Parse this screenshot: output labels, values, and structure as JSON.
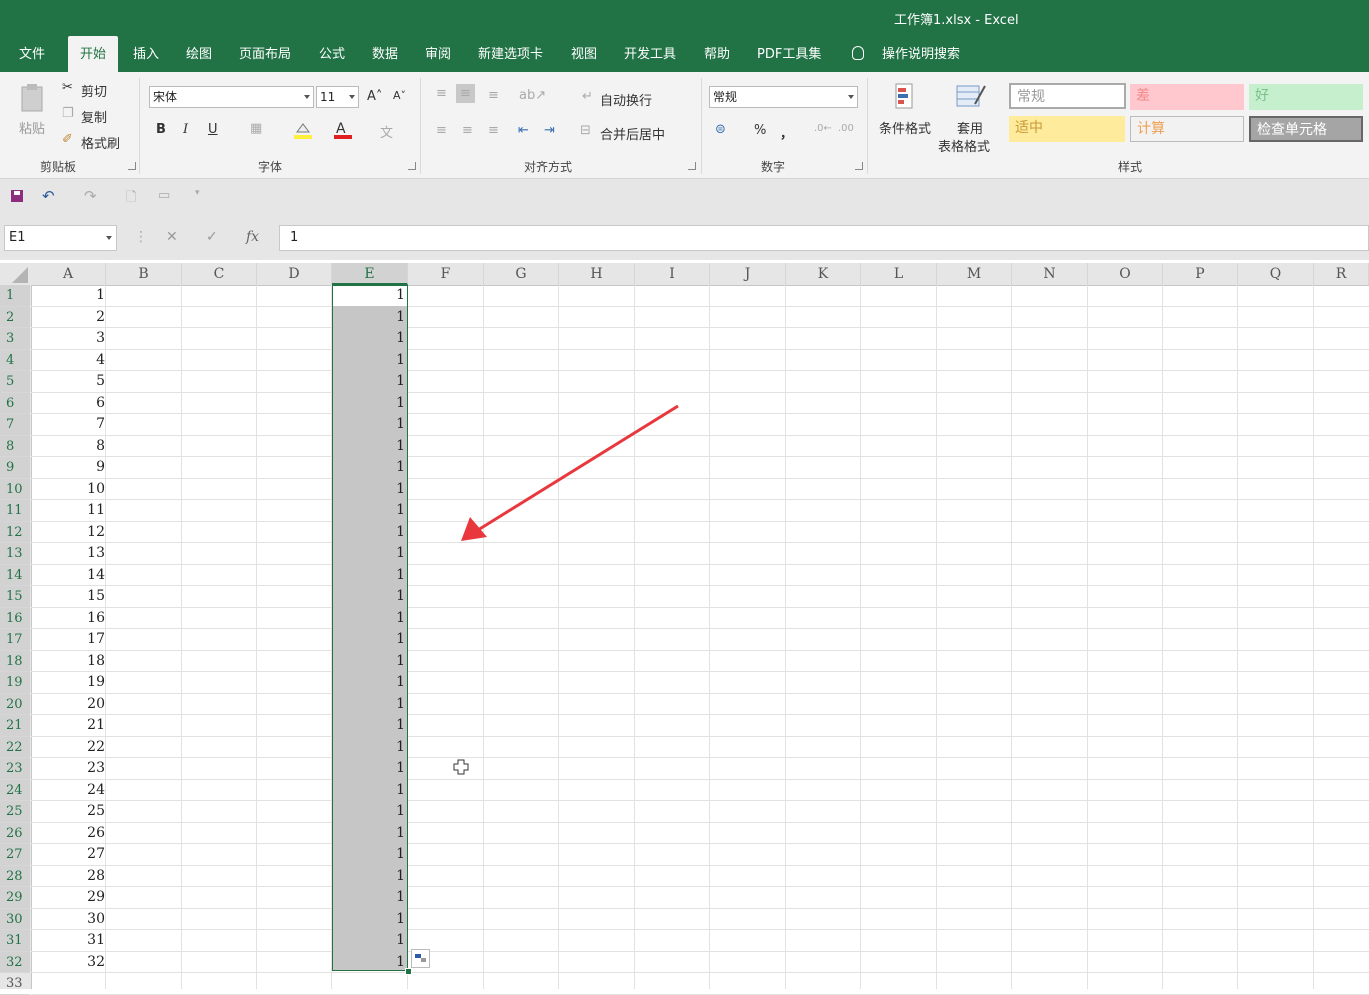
{
  "window": {
    "title": "工作簿1.xlsx  -  Excel"
  },
  "tabs": [
    {
      "label": "文件"
    },
    {
      "label": "开始"
    },
    {
      "label": "插入"
    },
    {
      "label": "绘图"
    },
    {
      "label": "页面布局"
    },
    {
      "label": "公式"
    },
    {
      "label": "数据"
    },
    {
      "label": "审阅"
    },
    {
      "label": "新建选项卡"
    },
    {
      "label": "视图"
    },
    {
      "label": "开发工具"
    },
    {
      "label": "帮助"
    },
    {
      "label": "PDF工具集"
    },
    {
      "label": "操作说明搜索"
    }
  ],
  "ribbon": {
    "clipboard": {
      "paste": "粘贴",
      "cut": "剪切",
      "copy": "复制",
      "format_painter": "格式刷",
      "group": "剪贴板"
    },
    "font": {
      "name": "宋体",
      "size": "11",
      "bold": "B",
      "italic": "I",
      "underline": "U",
      "group": "字体"
    },
    "alignment": {
      "wrap": "自动换行",
      "merge": "合并后居中",
      "group": "对齐方式"
    },
    "number": {
      "format": "常规",
      "percent": "%",
      "comma": "，",
      "group": "数字"
    },
    "styles": {
      "conditional": "条件格式",
      "table_line1": "套用",
      "table_line2": "表格格式",
      "normal": "常规",
      "bad": "差",
      "good": "好",
      "neutral": "适中",
      "calc": "计算",
      "check": "检查单元格",
      "group": "样式"
    }
  },
  "formula_bar": {
    "name_box": "E1",
    "fx": "fx",
    "value": "1"
  },
  "columns": [
    "A",
    "B",
    "C",
    "D",
    "E",
    "F",
    "G",
    "H",
    "I",
    "J",
    "K",
    "L",
    "M",
    "N",
    "O",
    "P",
    "Q",
    "R"
  ],
  "rows": [
    "1",
    "2",
    "3",
    "4",
    "5",
    "6",
    "7",
    "8",
    "9",
    "10",
    "11",
    "12",
    "13",
    "14",
    "15",
    "16",
    "17",
    "18",
    "19",
    "20",
    "21",
    "22",
    "23",
    "24",
    "25",
    "26",
    "27",
    "28",
    "29",
    "30",
    "31",
    "32",
    "33"
  ],
  "col_a_values": [
    "1",
    "2",
    "3",
    "4",
    "5",
    "6",
    "7",
    "8",
    "9",
    "10",
    "11",
    "12",
    "13",
    "14",
    "15",
    "16",
    "17",
    "18",
    "19",
    "20",
    "21",
    "22",
    "23",
    "24",
    "25",
    "26",
    "27",
    "28",
    "29",
    "30",
    "31",
    "32"
  ],
  "col_e_values": [
    "1",
    "1",
    "1",
    "1",
    "1",
    "1",
    "1",
    "1",
    "1",
    "1",
    "1",
    "1",
    "1",
    "1",
    "1",
    "1",
    "1",
    "1",
    "1",
    "1",
    "1",
    "1",
    "1",
    "1",
    "1",
    "1",
    "1",
    "1",
    "1",
    "1",
    "1",
    "1"
  ],
  "colors": {
    "accent": "#217346",
    "selection": "#c6c6c6",
    "arrow": "#e8383d",
    "bad_bg": "#ffc7ce",
    "good_bg": "#c6efce",
    "neutral_bg": "#ffeb9c",
    "check_bg": "#a5a5a5"
  }
}
